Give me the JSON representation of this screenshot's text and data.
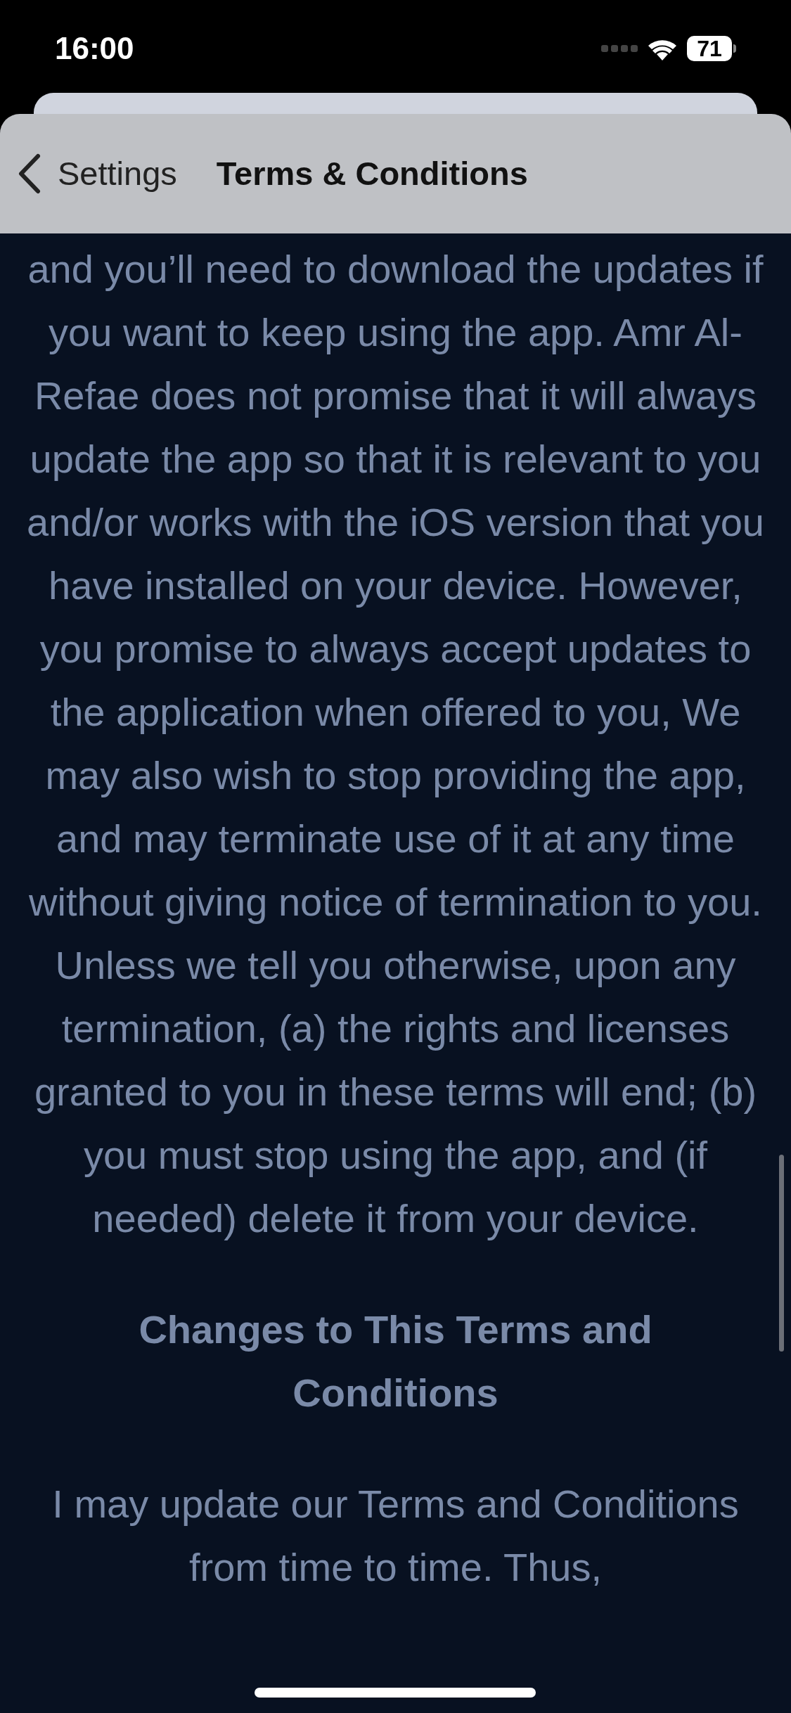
{
  "status_bar": {
    "time": "16:00",
    "battery": "71"
  },
  "nav": {
    "back": "Settings",
    "title": "Terms & Conditions"
  },
  "sections": [
    {
      "kind": "paragraph",
      "text": "and you’ll need to download the updates if you want to keep using the app. Amr Al-Refae does not promise that it will always update the app so that it is relevant to you and/or works with the iOS version that you have installed on your device. However, you promise to always accept updates to the application when offered to you, We may also wish to stop providing the app, and may terminate use of it at any time without giving notice of termination to you. Unless we tell you otherwise, upon any termination, (a) the rights and licenses granted to you in these terms will end; (b) you must stop using the app, and (if needed) delete it from your device."
    },
    {
      "kind": "heading",
      "text": "Changes to This Terms and Conditions"
    },
    {
      "kind": "paragraph",
      "text": "I may update our Terms and Conditions from time to time. Thus,"
    }
  ]
}
